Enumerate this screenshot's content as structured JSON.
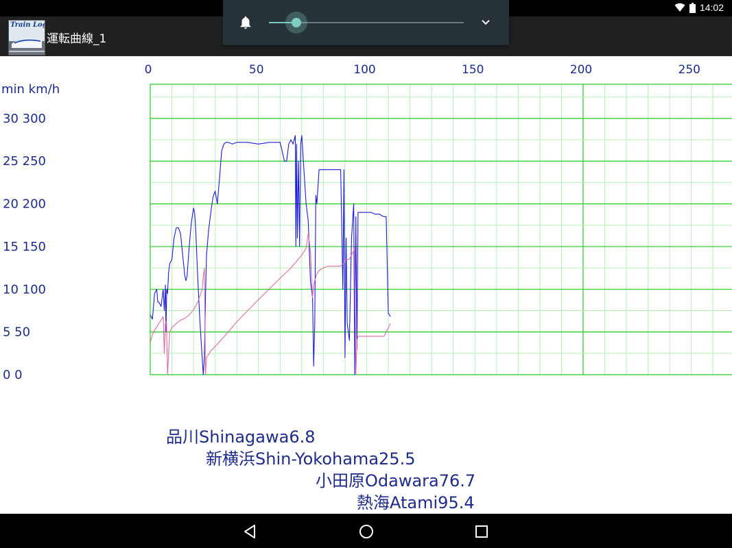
{
  "status_bar": {
    "time": "14:02",
    "icons": [
      "wifi-icon",
      "battery-icon"
    ]
  },
  "app_bar": {
    "icon_text": "Train Log",
    "title": "運転曲線_1"
  },
  "volume_panel": {
    "icon": "bell-icon",
    "level": 0.14,
    "expand_icon": "chevron-down-icon",
    "accent": "#80cbc4"
  },
  "nav_bar": {
    "buttons": [
      "back-icon",
      "home-icon",
      "recents-icon"
    ]
  },
  "stations": [
    {
      "name": "品川Shinagawa",
      "km": "6.8"
    },
    {
      "name": "新横浜Shin-Yokohama",
      "km": "25.5"
    },
    {
      "name": "小田原Odawara",
      "km": "76.7"
    },
    {
      "name": "熱海Atami",
      "km": "95.4"
    }
  ],
  "chart_data": {
    "type": "line",
    "title": "",
    "xlabel": "",
    "ylabel": "min km/h",
    "xlim": [
      0,
      270
    ],
    "x_ticks": [
      "0",
      "50",
      "100",
      "150",
      "200",
      "250"
    ],
    "y_ticks": [
      "0  0",
      "5  50",
      "10 100",
      "15 150",
      "20 200",
      "25 250",
      "30 300"
    ],
    "ylim": [
      0,
      340
    ],
    "grid": true,
    "grid_color": "#33dd33",
    "series": [
      {
        "color": "#1a1ad8",
        "x": [
          0,
          1,
          2,
          3,
          3.5,
          4,
          5,
          6,
          6.5,
          7,
          7.3,
          7.6,
          8,
          8.5,
          9,
          10,
          11,
          12,
          13,
          14,
          15,
          16,
          16.5,
          17,
          18,
          19,
          20,
          20.5,
          21,
          22,
          23,
          24,
          24.5,
          25,
          25.5,
          26,
          27,
          28,
          29,
          30,
          31,
          32,
          33,
          34,
          35,
          36,
          38,
          40,
          45,
          50,
          55,
          60,
          62,
          63,
          64,
          65,
          66,
          67,
          67.3,
          67.6,
          68,
          68.5,
          69,
          69.5,
          70,
          71,
          72,
          73,
          74,
          75,
          75.5,
          76,
          76.5,
          77,
          78,
          79,
          80,
          82,
          85,
          88,
          89,
          89.5,
          90,
          90.5,
          91,
          92,
          93,
          94,
          94.5,
          95,
          95.5,
          96,
          97,
          98,
          99,
          100,
          102,
          104,
          106,
          107,
          108,
          109,
          110,
          111
        ],
        "y": [
          70,
          65,
          95,
          100,
          85,
          85,
          80,
          100,
          75,
          105,
          50,
          100,
          95,
          120,
          130,
          135,
          160,
          172,
          172,
          165,
          140,
          115,
          110,
          115,
          150,
          178,
          195,
          190,
          170,
          110,
          60,
          20,
          0,
          20,
          90,
          140,
          170,
          190,
          208,
          215,
          200,
          230,
          262,
          270,
          272,
          272,
          270,
          272,
          272,
          270,
          272,
          272,
          250,
          250,
          270,
          275,
          270,
          280,
          150,
          270,
          160,
          250,
          150,
          270,
          280,
          240,
          200,
          180,
          110,
          90,
          10,
          60,
          210,
          200,
          240,
          240,
          240,
          240,
          240,
          240,
          100,
          240,
          20,
          160,
          60,
          40,
          160,
          200,
          0,
          185,
          30,
          190,
          190,
          190,
          190,
          190,
          190,
          188,
          188,
          186,
          185,
          185,
          72,
          68
        ]
      },
      {
        "color": "#e06aa8",
        "x": [
          0,
          1,
          2,
          3,
          4,
          5,
          6,
          6.5,
          7,
          7.5,
          8,
          9,
          10,
          12,
          14,
          16,
          18,
          20,
          22,
          24,
          24.5,
          25,
          25.5,
          26,
          27,
          28,
          30,
          35,
          40,
          50,
          60,
          65,
          70,
          72,
          73,
          74,
          75,
          75.5,
          76,
          77,
          78,
          80,
          82,
          85,
          88,
          89,
          89.5,
          90,
          92,
          93,
          94,
          94.5,
          95,
          95.5,
          96,
          97,
          98,
          100,
          102,
          104,
          106,
          108,
          110,
          111
        ],
        "y": [
          37,
          47,
          52,
          56,
          60,
          64,
          68,
          25,
          60,
          62,
          0,
          50,
          55,
          60,
          64,
          66,
          70,
          76,
          85,
          100,
          115,
          125,
          0,
          20,
          24,
          28,
          33,
          47,
          62,
          88,
          113,
          125,
          140,
          148,
          165,
          145,
          90,
          105,
          110,
          118,
          122,
          125,
          127,
          127,
          127,
          130,
          130,
          135,
          135,
          140,
          145,
          150,
          0,
          40,
          45,
          45,
          45,
          45,
          45,
          45,
          45,
          45,
          55,
          60
        ]
      }
    ]
  }
}
